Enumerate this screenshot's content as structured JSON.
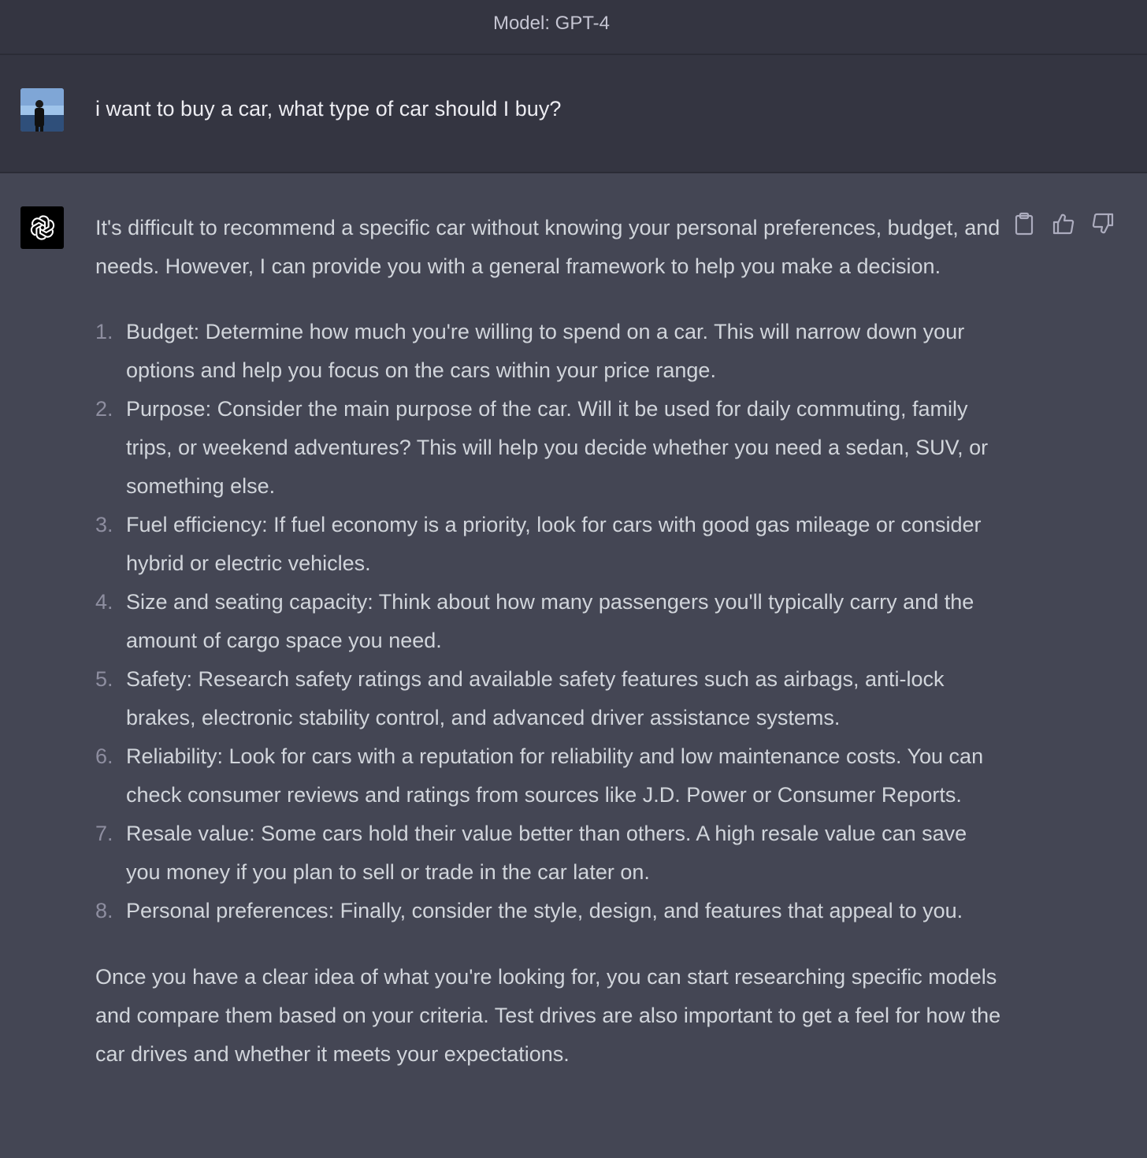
{
  "header": {
    "model_label": "Model: GPT-4"
  },
  "user_message": {
    "text": "i want to buy a car, what type of car should I buy?"
  },
  "assistant_message": {
    "intro": "It's difficult to recommend a specific car without knowing your personal preferences, budget, and needs. However, I can provide you with a general framework to help you make a decision.",
    "items": [
      {
        "num": "1.",
        "text": "Budget: Determine how much you're willing to spend on a car. This will narrow down your options and help you focus on the cars within your price range."
      },
      {
        "num": "2.",
        "text": "Purpose: Consider the main purpose of the car. Will it be used for daily commuting, family trips, or weekend adventures? This will help you decide whether you need a sedan, SUV, or something else."
      },
      {
        "num": "3.",
        "text": "Fuel efficiency: If fuel economy is a priority, look for cars with good gas mileage or consider hybrid or electric vehicles."
      },
      {
        "num": "4.",
        "text": "Size and seating capacity: Think about how many passengers you'll typically carry and the amount of cargo space you need."
      },
      {
        "num": "5.",
        "text": "Safety: Research safety ratings and available safety features such as airbags, anti-lock brakes, electronic stability control, and advanced driver assistance systems."
      },
      {
        "num": "6.",
        "text": "Reliability: Look for cars with a reputation for reliability and low maintenance costs. You can check consumer reviews and ratings from sources like J.D. Power or Consumer Reports."
      },
      {
        "num": "7.",
        "text": "Resale value: Some cars hold their value better than others. A high resale value can save you money if you plan to sell or trade in the car later on."
      },
      {
        "num": "8.",
        "text": "Personal preferences: Finally, consider the style, design, and features that appeal to you."
      }
    ],
    "outro": "Once you have a clear idea of what you're looking for, you can start researching specific models and compare them based on your criteria. Test drives are also important to get a feel for how the car drives and whether it meets your expectations."
  },
  "icons": {
    "user_avatar": "user-avatar-photo",
    "assistant_logo": "openai-logo-icon",
    "copy": "clipboard-icon",
    "thumbs_up": "thumbs-up-icon",
    "thumbs_down": "thumbs-down-icon"
  },
  "colors": {
    "header_bg": "#343541",
    "user_bg": "#343541",
    "assistant_bg": "#444654",
    "text": "#d1d5db",
    "list_number": "#8e8ea0"
  }
}
